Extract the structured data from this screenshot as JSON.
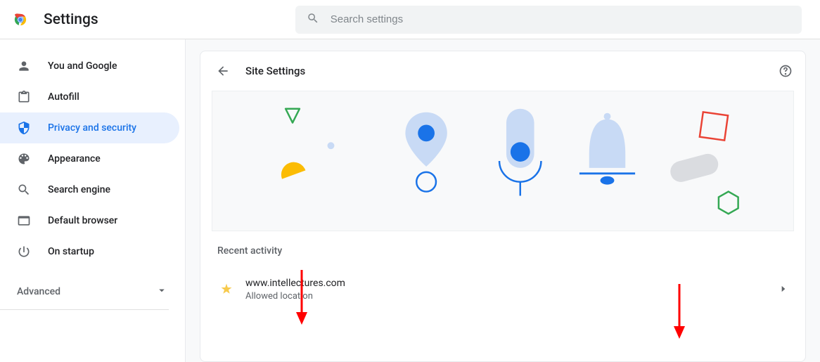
{
  "header": {
    "title": "Settings",
    "search_placeholder": "Search settings"
  },
  "sidebar": {
    "items": [
      {
        "id": "you-and-google",
        "label": "You and Google"
      },
      {
        "id": "autofill",
        "label": "Autofill"
      },
      {
        "id": "privacy",
        "label": "Privacy and security",
        "active": true
      },
      {
        "id": "appearance",
        "label": "Appearance"
      },
      {
        "id": "search-engine",
        "label": "Search engine"
      },
      {
        "id": "default-browser",
        "label": "Default browser"
      },
      {
        "id": "on-startup",
        "label": "On startup"
      }
    ],
    "advanced_label": "Advanced"
  },
  "main": {
    "page_title": "Site Settings",
    "recent_activity_label": "Recent activity",
    "activities": [
      {
        "site": "www.intellectures.com",
        "status": "Allowed location"
      }
    ]
  }
}
